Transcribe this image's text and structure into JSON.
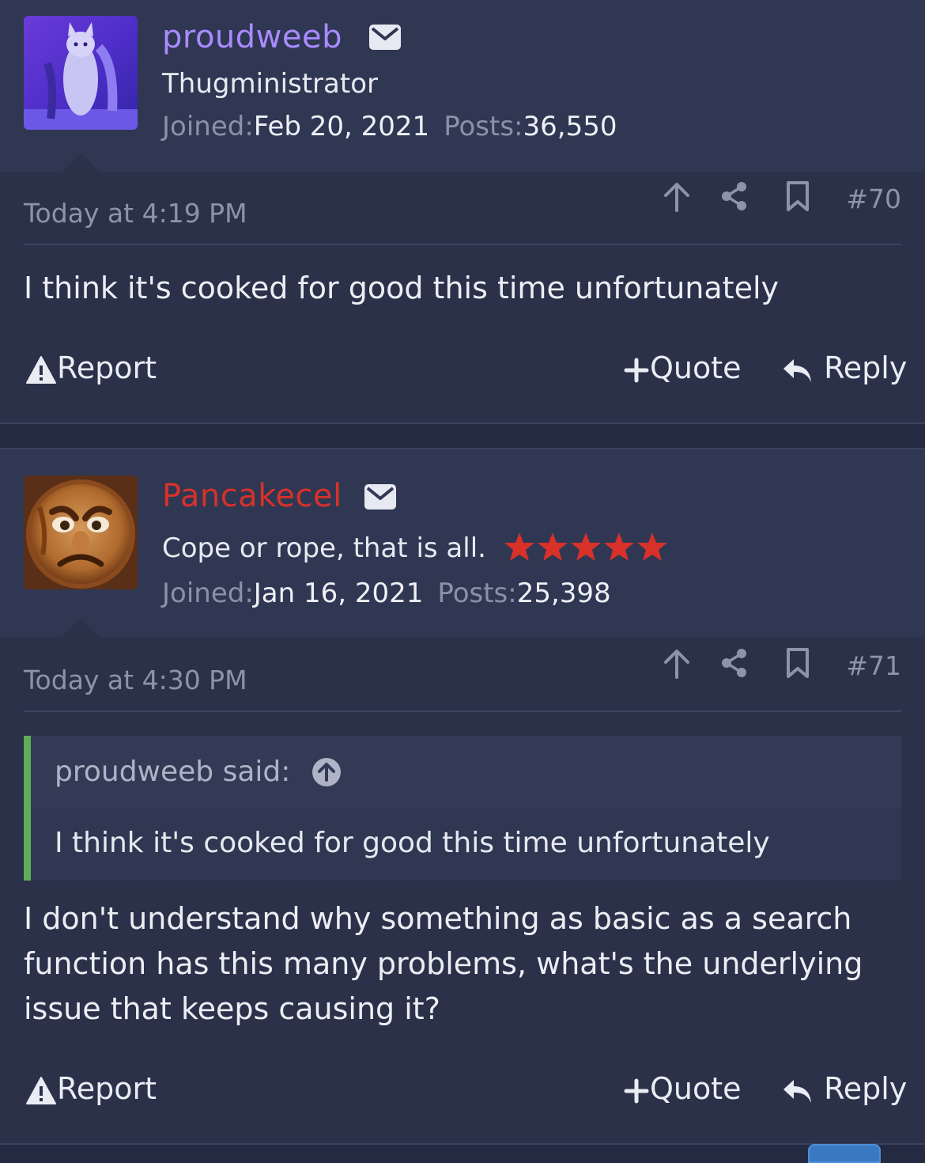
{
  "posts": [
    {
      "username": "proudweeb",
      "user_title": "Thugministrator",
      "joined_label": "Joined:",
      "joined_value": "Feb 20, 2021",
      "posts_label": "Posts:",
      "posts_value": "36,550",
      "timestamp": "Today at 4:19 PM",
      "post_number": "#70",
      "body": "I think it's cooked for good this time unfortunately",
      "report_label": "Report",
      "quote_label": "Quote",
      "reply_label": "Reply"
    },
    {
      "username": "Pancakecel",
      "user_title": "Cope or rope, that is all.",
      "star_rating": 5,
      "joined_label": "Joined:",
      "joined_value": "Jan 16, 2021",
      "posts_label": "Posts:",
      "posts_value": "25,398",
      "timestamp": "Today at 4:30 PM",
      "post_number": "#71",
      "quote_author": "proudweeb said:",
      "quote_body": "I think it's cooked for good this time unfortunately",
      "body": "I don't understand why something as basic as a search function has this many problems, what's the underlying issue that keeps causing it?",
      "report_label": "Report",
      "quote_label": "Quote",
      "reply_label": "Reply"
    }
  ],
  "icons": {
    "mail": "mail-icon",
    "upvote": "arrow-up-icon",
    "share": "share-icon",
    "bookmark": "bookmark-icon",
    "report": "warning-icon",
    "quote": "plus-icon",
    "reply": "reply-icon",
    "quote_jump": "arrow-up-circle-icon",
    "rating_star": "star-icon"
  },
  "colors": {
    "username_1": "#a98bff",
    "username_2": "#d7312a",
    "star": "#d7312a",
    "quote_bar": "#5fae57",
    "background": "#2a3149",
    "user_block": "#2f3753"
  }
}
